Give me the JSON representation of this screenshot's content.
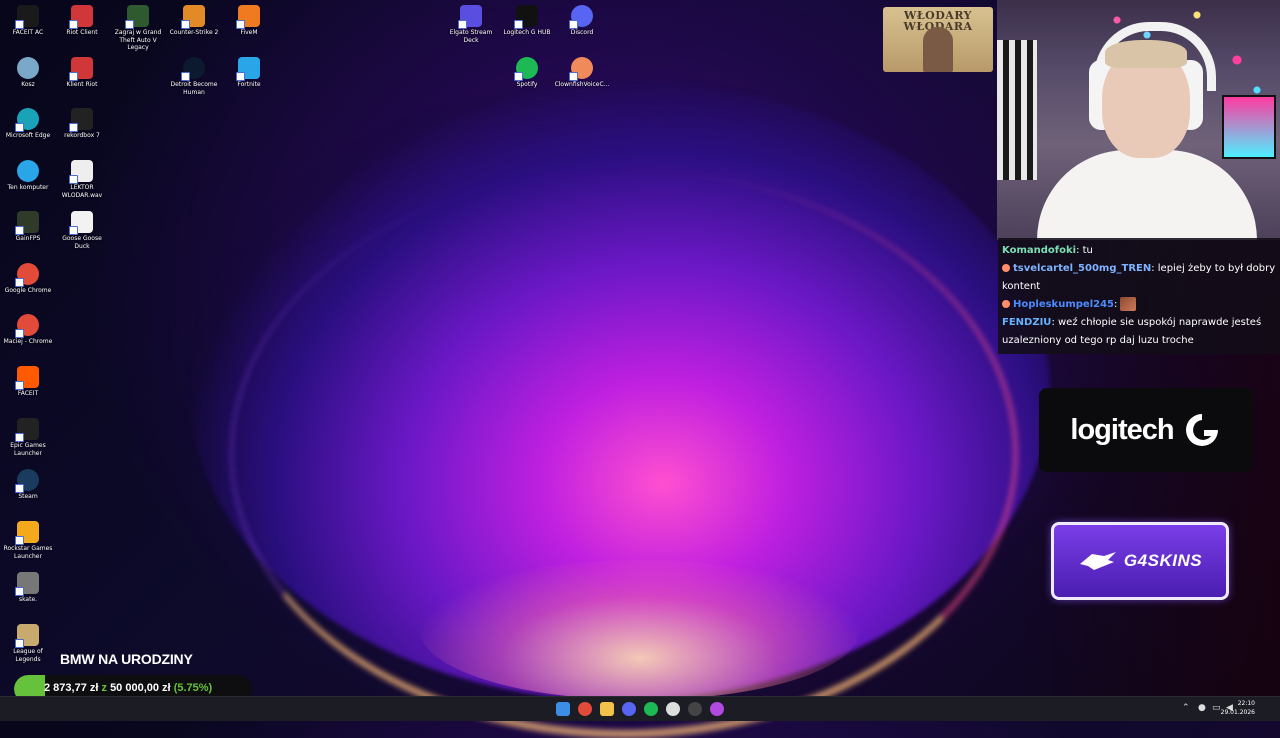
{
  "desktop": {
    "icons": [
      {
        "label": "FACEIT AC",
        "icon": "faceit-ac-icon",
        "color": "#1a1a1a"
      },
      {
        "label": "Riot Client",
        "icon": "riot-client-icon",
        "color": "#d13639"
      },
      {
        "label": "Zagraj w Grand Theft Auto V Legacy",
        "icon": "gta-v-icon",
        "color": "#2f5a30"
      },
      {
        "label": "Counter-Strike 2",
        "icon": "cs2-icon",
        "color": "#e28a25"
      },
      {
        "label": "FiveM",
        "icon": "fivem-icon",
        "color": "#f07a20"
      },
      {
        "label": "Kosz",
        "icon": "recycle-bin-icon",
        "color": "#7aa8c8"
      },
      {
        "label": "Klient Riot",
        "icon": "riot-client-icon",
        "color": "#d13639"
      },
      {
        "label": "Detroit Become Human",
        "icon": "detroit-icon",
        "color": "#0b1a2e"
      },
      {
        "label": "Fortnite",
        "icon": "fortnite-icon",
        "color": "#2aa6e8"
      },
      {
        "label": "Microsoft Edge",
        "icon": "edge-icon",
        "color": "#1aa3b8"
      },
      {
        "label": "rekordbox 7",
        "icon": "rekordbox-icon",
        "color": "#222222"
      },
      {
        "label": "Ten komputer",
        "icon": "this-pc-icon",
        "color": "#2aa6e8"
      },
      {
        "label": "LEKTOR WLODAR.wav",
        "icon": "wav-file-icon",
        "color": "#eeeeee"
      },
      {
        "label": "GainFPS",
        "icon": "gainfps-icon",
        "color": "#2f3a28"
      },
      {
        "label": "Goose Goose Duck",
        "icon": "goose-goose-duck-icon",
        "color": "#f2f2f2"
      },
      {
        "label": "Google Chrome",
        "icon": "chrome-icon",
        "color": "#e24a3a"
      },
      {
        "label": "Maciej - Chrome",
        "icon": "chrome-icon",
        "color": "#e24a3a"
      },
      {
        "label": "FACEIT",
        "icon": "faceit-icon",
        "color": "#ff5a00"
      },
      {
        "label": "Epic Games Launcher",
        "icon": "epic-games-icon",
        "color": "#222222"
      },
      {
        "label": "Steam",
        "icon": "steam-icon",
        "color": "#1b3b5e"
      },
      {
        "label": "Rockstar Games Launcher",
        "icon": "rockstar-icon",
        "color": "#f4a81c"
      },
      {
        "label": "skate.",
        "icon": "skate-icon",
        "color": "#777777"
      },
      {
        "label": "League of Legends",
        "icon": "league-icon",
        "color": "#c8aa6e"
      },
      {
        "label": "Elgato Stream Deck",
        "icon": "stream-deck-icon",
        "color": "#5a4ee0"
      },
      {
        "label": "Logitech G HUB",
        "icon": "logitech-ghub-icon",
        "color": "#111111"
      },
      {
        "label": "Discord",
        "icon": "discord-icon",
        "color": "#5865f2"
      },
      {
        "label": "Spotify",
        "icon": "spotify-icon",
        "color": "#1db954"
      },
      {
        "label": "ClownfishVoiceC...",
        "icon": "clownfish-icon",
        "color": "#f08a5a"
      }
    ]
  },
  "overlay": {
    "banner_text": "WŁODARY WŁODARA",
    "chat": {
      "messages": [
        {
          "user": "Komandofoki",
          "user_color": "#7de0b5",
          "text": ": tu",
          "badge": false,
          "emote": false
        },
        {
          "user": "tsvelcartel_500mg_TREN",
          "user_color": "#7eb3ff",
          "text": ": lepiej żeby to był dobry kontent",
          "badge": true,
          "emote": false
        },
        {
          "user": "Hopleskumpel245",
          "user_color": "#4d8bff",
          "text": ":",
          "badge": true,
          "emote": true
        },
        {
          "user": "FENDZIU",
          "user_color": "#66b2ff",
          "text": ": weź chłopie sie uspokój naprawde jesteś uzalezniony od tego rp daj luzu troche",
          "badge": false,
          "emote": false
        }
      ]
    },
    "sponsor_logitech": "logitech",
    "sponsor_g4skins": "G4SKINS",
    "goal": {
      "title": "BMW NA URODZINY",
      "current": "2 873,77 zł",
      "separator": "z",
      "target": "50 000,00 zł",
      "percent_label": "(5.75%)",
      "progress": 0.0575,
      "color": "#65c23a"
    }
  },
  "taskbar": {
    "apps": [
      {
        "icon": "windows-start-icon",
        "color": "#3a8ee6"
      },
      {
        "icon": "chrome-icon",
        "color": "#e24a3a"
      },
      {
        "icon": "file-explorer-icon",
        "color": "#f2c14a"
      },
      {
        "icon": "discord-icon",
        "color": "#5865f2"
      },
      {
        "icon": "spotify-icon",
        "color": "#1db954"
      },
      {
        "icon": "logitech-ghub-icon",
        "color": "#dddddd"
      },
      {
        "icon": "obs-icon",
        "color": "#444444"
      },
      {
        "icon": "chrome-profile-icon",
        "color": "#b04ae0"
      }
    ],
    "time": "22:10",
    "date": "29.01.2026"
  }
}
